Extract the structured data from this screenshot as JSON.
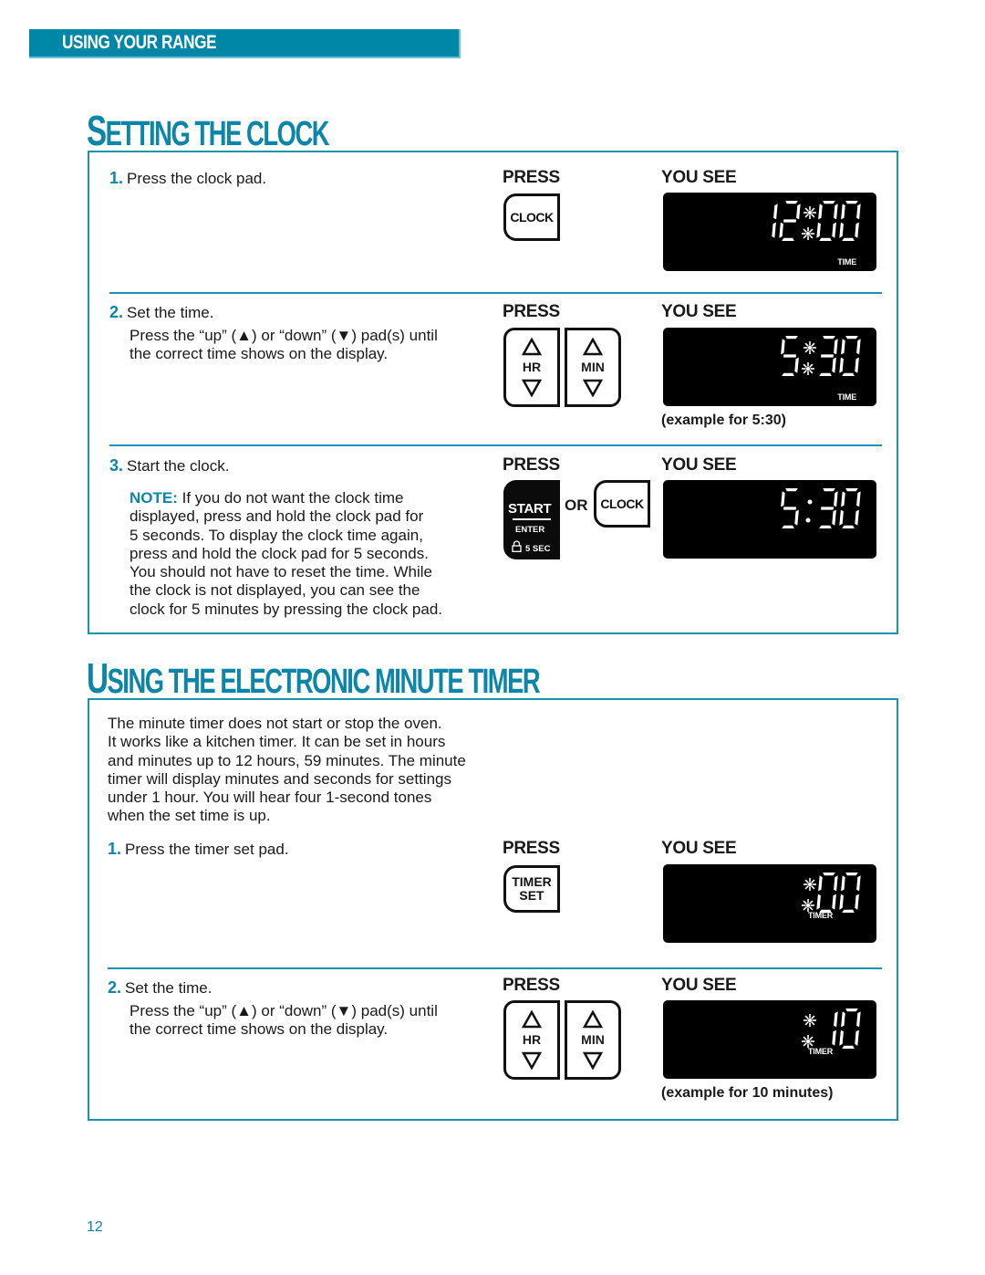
{
  "header": {
    "band_label": "USING YOUR RANGE"
  },
  "sections": {
    "clock": {
      "title_first": "S",
      "title_rest": "ETTING THE CLOCK",
      "steps": [
        {
          "num": "1.",
          "text": "Press the clock pad.",
          "press_label": "PRESS",
          "you_see_label": "YOU SEE",
          "pad": "CLOCK",
          "display_value": "12:00",
          "display_indicator": "TIME"
        },
        {
          "num": "2.",
          "text": "Set the time.",
          "detail_lines": [
            "Press the “up” (▲) or “down” (▼) pad(s) until",
            "the correct time shows on the display."
          ],
          "press_label": "PRESS",
          "you_see_label": "YOU SEE",
          "pad_left": "HR",
          "pad_right": "MIN",
          "display_value": "5:30",
          "display_indicator": "TIME",
          "caption": "(example for 5:30)"
        },
        {
          "num": "3.",
          "text": "Start the clock.",
          "note_label": "NOTE:",
          "note_lines": [
            " If you do not want the clock time",
            "displayed, press and hold the clock pad for",
            "5 seconds. To display the clock time again,",
            "press and hold the clock pad for 5 seconds.",
            "You should not have to reset the time. While",
            "the clock is not displayed, you can see the",
            "clock for 5 minutes by pressing the clock pad."
          ],
          "press_label": "PRESS",
          "you_see_label": "YOU SEE",
          "start_pad": {
            "start": "START",
            "enter": "ENTER",
            "hold": "5 SEC"
          },
          "or_label": "OR",
          "pad": "CLOCK",
          "display_value": "5:30"
        }
      ]
    },
    "timer": {
      "title_first": "U",
      "title_rest": "SING THE ELECTRONIC MINUTE TIMER",
      "intro_lines": [
        "The minute timer does not start or stop the oven.",
        "It works like a kitchen timer. It can be set in hours",
        "and minutes up to 12 hours, 59 minutes. The minute",
        "timer will display minutes and seconds for settings",
        "under 1 hour. You will hear four 1-second tones",
        "when the set time is up."
      ],
      "steps": [
        {
          "num": "1.",
          "text": "Press the timer set pad.",
          "press_label": "PRESS",
          "you_see_label": "YOU SEE",
          "pad_line1": "TIMER",
          "pad_line2": "SET",
          "display_value": ":00",
          "display_indicator": "TIMER"
        },
        {
          "num": "2.",
          "text": "Set the time.",
          "detail_lines": [
            "Press the “up” (▲) or “down” (▼) pad(s) until",
            "the correct time shows on the display."
          ],
          "press_label": "PRESS",
          "you_see_label": "YOU SEE",
          "pad_left": "HR",
          "pad_right": "MIN",
          "display_value": ":10",
          "display_indicator": "TIMER",
          "caption": "(example for 10 minutes)"
        }
      ]
    }
  },
  "colors": {
    "accent": "#0b86a8",
    "band": "#0087a8",
    "display_bg": "#000000",
    "segment": "#ffffff"
  },
  "page_number": "12"
}
